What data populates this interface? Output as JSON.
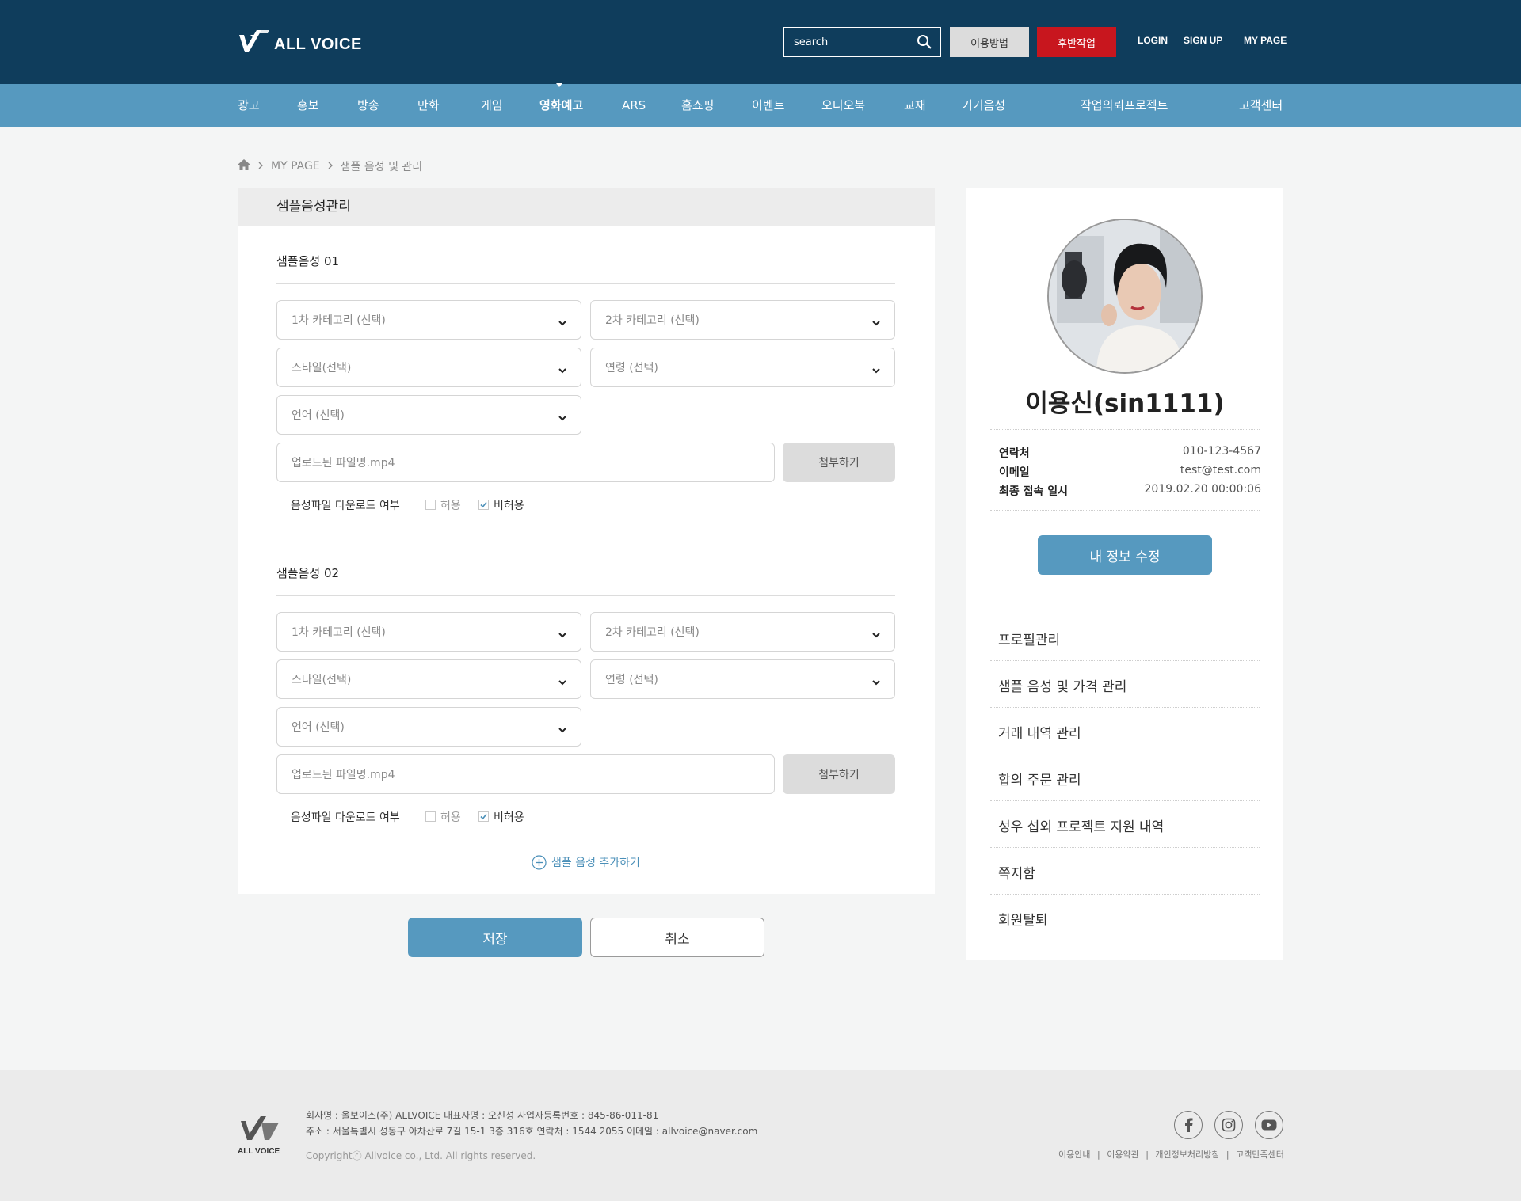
{
  "header": {
    "logo_text": "ALL VOICE",
    "search_placeholder": "search",
    "guide_button": "이용방법",
    "post_button": "후반작업",
    "login": "LOGIN",
    "signup": "SIGN UP",
    "mypage": "MY PAGE"
  },
  "nav": {
    "items": [
      "광고",
      "홍보",
      "방송",
      "만화",
      "게임",
      "영화예고",
      "ARS",
      "홈쇼핑",
      "이벤트",
      "오디오북",
      "교재",
      "기기음성",
      "작업의뢰프로젝트",
      "고객센터"
    ],
    "separator": "|"
  },
  "breadcrumb": {
    "items": [
      "MY PAGE",
      "샘플 음성 및 관리"
    ]
  },
  "main": {
    "panel_title": "샘플음성관리",
    "samples": [
      {
        "title": "샘플음성 01",
        "category1": "1차 카테고리 (선택)",
        "category2": "2차 카테고리 (선택)",
        "style": "스타일(선택)",
        "age": "연령 (선택)",
        "language": "언어 (선택)",
        "file_placeholder": "업로드된 파일명.mp4",
        "attach": "첨부하기",
        "download_label": "음성파일 다운로드 여부",
        "allow": "허용",
        "deny": "비허용"
      },
      {
        "title": "샘플음성 02",
        "category1": "1차 카테고리 (선택)",
        "category2": "2차 카테고리 (선택)",
        "style": "스타일(선택)",
        "age": "연령 (선택)",
        "language": "언어 (선택)",
        "file_placeholder": "업로드된 파일명.mp4",
        "attach": "첨부하기",
        "download_label": "음성파일 다운로드 여부",
        "allow": "허용",
        "deny": "비허용"
      }
    ],
    "add_more": "샘플 음성 추가하기",
    "save": "저장",
    "cancel": "취소"
  },
  "side": {
    "user_name": "이용신(sin1111)",
    "info": [
      {
        "key": "연락처",
        "value": "010-123-4567"
      },
      {
        "key": "이메일",
        "value": "test@test.com"
      },
      {
        "key": "최종 접속 일시",
        "value": "2019.02.20 00:00:06"
      }
    ],
    "edit_button": "내 정보 수정",
    "menu": [
      "프로필관리",
      "샘플 음성 및 가격 관리",
      "거래 내역 관리",
      "합의 주문 관리",
      "성우 섭외 프로젝트 지원 내역",
      "쪽지함",
      "회원탈퇴"
    ]
  },
  "footer": {
    "logo_text": "ALL VOICE",
    "line1": "회사명 : 올보이스(주) ALLVOICE  대표자명 : 오신성  사업자등록번호 : 845-86-011-81",
    "line2": "주소 : 서울특별시 성동구 아차산로 7길 15-1 3층 316호  연락처 : 1544 2055  이메일 : allvoice@naver.com",
    "copyright": "Copyrightⓒ Allvoice co., Ltd. All rights reserved.",
    "links": [
      "이용안내",
      "이용약관",
      "개인정보처리방침",
      "고객만족센터"
    ]
  }
}
